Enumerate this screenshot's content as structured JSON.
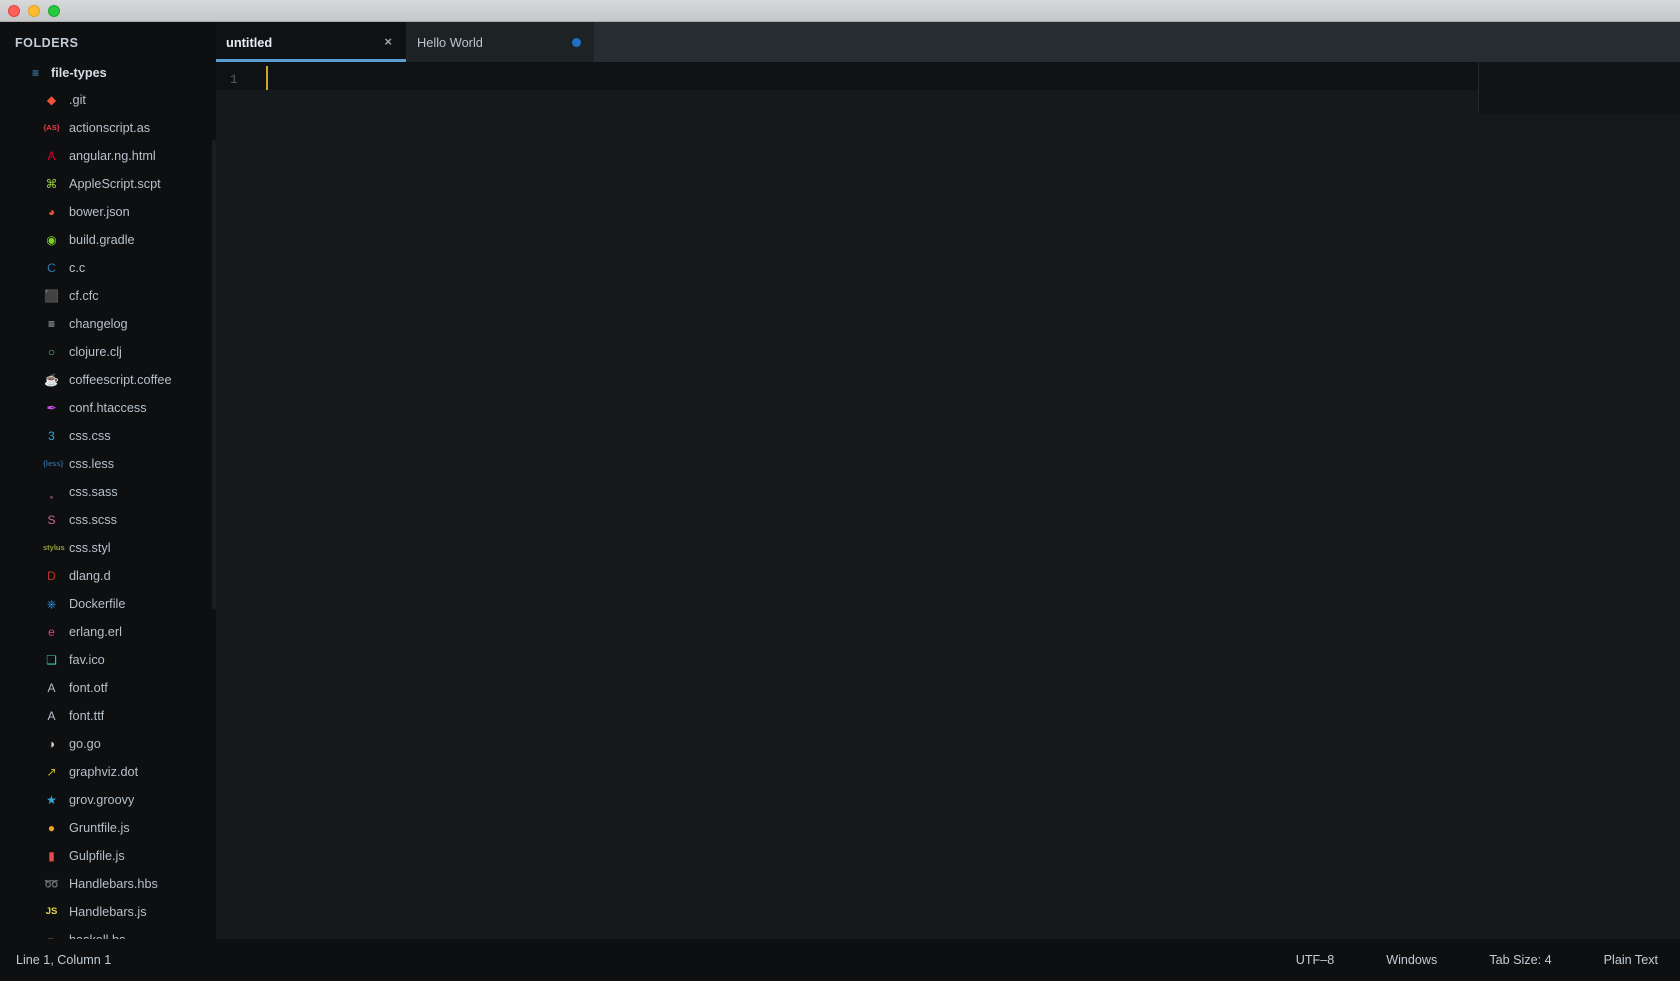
{
  "window": {
    "traffic_lights": [
      "close",
      "minimize",
      "maximize"
    ]
  },
  "sidebar": {
    "header": "FOLDERS",
    "folder": {
      "label": "file-types",
      "icon": "folder-list-icon"
    },
    "files": [
      {
        "name": ".git",
        "icon": "git-icon",
        "glyph": "◆",
        "color": "#f05033"
      },
      {
        "name": "actionscript.as",
        "icon": "actionscript-icon",
        "glyph": "{AS}",
        "color": "#e8424a"
      },
      {
        "name": "angular.ng.html",
        "icon": "angular-icon",
        "glyph": "A",
        "color": "#dd0031"
      },
      {
        "name": "AppleScript.scpt",
        "icon": "apple-icon",
        "glyph": "⌘",
        "color": "#9ccc3c"
      },
      {
        "name": "bower.json",
        "icon": "bower-icon",
        "glyph": "◕",
        "color": "#ef5734"
      },
      {
        "name": "build.gradle",
        "icon": "gradle-icon",
        "glyph": "◉",
        "color": "#7ed321"
      },
      {
        "name": "c.c",
        "icon": "c-lang-icon",
        "glyph": "C",
        "color": "#2b7ab3"
      },
      {
        "name": "cf.cfc",
        "icon": "coldfusion-icon",
        "glyph": "⬛",
        "color": "#2f7fd1"
      },
      {
        "name": "changelog",
        "icon": "changelog-icon",
        "glyph": "≡",
        "color": "#c3cdd6"
      },
      {
        "name": "clojure.clj",
        "icon": "clojure-icon",
        "glyph": "○",
        "color": "#5dbb63"
      },
      {
        "name": "coffeescript.coffee",
        "icon": "coffee-icon",
        "glyph": "☕",
        "color": "#e0a346"
      },
      {
        "name": "conf.htaccess",
        "icon": "apache-icon",
        "glyph": "✒",
        "color": "#c64ee0"
      },
      {
        "name": "css.css",
        "icon": "css3-icon",
        "glyph": "3",
        "color": "#29a9df"
      },
      {
        "name": "css.less",
        "icon": "less-icon",
        "glyph": "{less}",
        "color": "#2a6496"
      },
      {
        "name": "css.sass",
        "icon": "sass-icon",
        "glyph": "͓",
        "color": "#cf649a"
      },
      {
        "name": "css.scss",
        "icon": "scss-icon",
        "glyph": "S",
        "color": "#cf649a"
      },
      {
        "name": "css.styl",
        "icon": "stylus-icon",
        "glyph": "stylus",
        "color": "#94a13a"
      },
      {
        "name": "dlang.d",
        "icon": "dlang-icon",
        "glyph": "D",
        "color": "#c0392b"
      },
      {
        "name": "Dockerfile",
        "icon": "docker-icon",
        "glyph": "⎈",
        "color": "#2496ed"
      },
      {
        "name": "erlang.erl",
        "icon": "erlang-icon",
        "glyph": "e",
        "color": "#e8407f"
      },
      {
        "name": "fav.ico",
        "icon": "image-icon",
        "glyph": "❑",
        "color": "#3ec9a7"
      },
      {
        "name": "font.otf",
        "icon": "font-icon",
        "glyph": "A",
        "color": "#b6c0c9"
      },
      {
        "name": "font.ttf",
        "icon": "font-icon",
        "glyph": "A",
        "color": "#b6c0c9"
      },
      {
        "name": "go.go",
        "icon": "golang-icon",
        "glyph": "◑",
        "color": "#d9d0bb"
      },
      {
        "name": "graphviz.dot",
        "icon": "graph-icon",
        "glyph": "↗",
        "color": "#c8b820"
      },
      {
        "name": "grov.groovy",
        "icon": "groovy-icon",
        "glyph": "★",
        "color": "#34a7d8"
      },
      {
        "name": "Gruntfile.js",
        "icon": "grunt-icon",
        "glyph": "●",
        "color": "#f0a31f"
      },
      {
        "name": "Gulpfile.js",
        "icon": "gulp-icon",
        "glyph": "▮",
        "color": "#eb4a4b"
      },
      {
        "name": "Handlebars.hbs",
        "icon": "handlebars-icon",
        "glyph": "➿",
        "color": "#d4812a"
      },
      {
        "name": "Handlebars.js",
        "icon": "javascript-icon",
        "glyph": "JS",
        "color": "#e8d44d"
      },
      {
        "name": "haskell.hs",
        "icon": "haskell-icon",
        "glyph": "»",
        "color": "#e8762a"
      }
    ]
  },
  "tabs": [
    {
      "label": "untitled",
      "active": true,
      "dirty": false,
      "close_glyph": "×"
    },
    {
      "label": "Hello World",
      "active": false,
      "dirty": true
    }
  ],
  "editor": {
    "line_numbers": [
      "1"
    ],
    "content": "",
    "caret_visible": true
  },
  "statusbar": {
    "position": "Line 1, Column 1",
    "encoding": "UTF–8",
    "line_endings": "Windows",
    "tab_size": "Tab Size: 4",
    "syntax": "Plain Text"
  },
  "colors": {
    "accent": "#5a9fd4",
    "dirty_dot": "#1f6fc4",
    "caret": "#d2a32c",
    "sidebar_bg": "#0d0f11",
    "editor_bg": "#16191c",
    "tabbar_bg": "#272c31"
  }
}
